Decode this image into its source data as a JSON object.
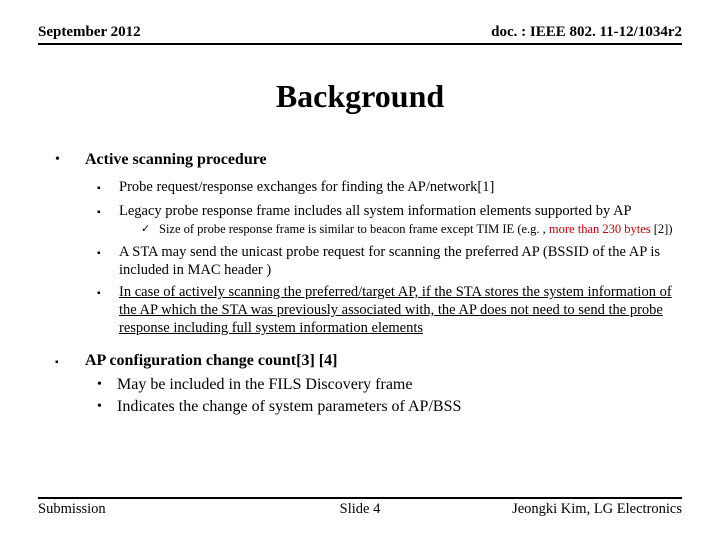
{
  "header": {
    "left": "September 2012",
    "right": "doc. : IEEE 802. 11-12/1034r2"
  },
  "title": "Background",
  "section1": {
    "heading": "Active scanning procedure",
    "items": [
      "Probe request/response exchanges for finding the AP/network[1]",
      "Legacy probe response frame includes all system information elements supported by AP"
    ],
    "check_prefix": "Size of probe response frame is similar to beacon frame except TIM IE (e.g. , ",
    "check_red": "more than 230 bytes ",
    "check_suffix": "[2])",
    "item3": "A STA may send the unicast probe request for scanning the preferred AP (BSSID of the AP is included in MAC header )",
    "item4": "In case of actively scanning the preferred/target AP, if the STA stores the system information of the AP which the STA was previously associated with, the AP does not need to send the probe response including full system information elements"
  },
  "section2": {
    "heading": "AP configuration change count[3] [4]",
    "items": [
      "May be included in the FILS Discovery frame",
      "Indicates the change of system parameters of AP/BSS"
    ]
  },
  "footer": {
    "left": "Submission",
    "center": "Slide 4",
    "right": "Jeongki Kim, LG Electronics"
  }
}
